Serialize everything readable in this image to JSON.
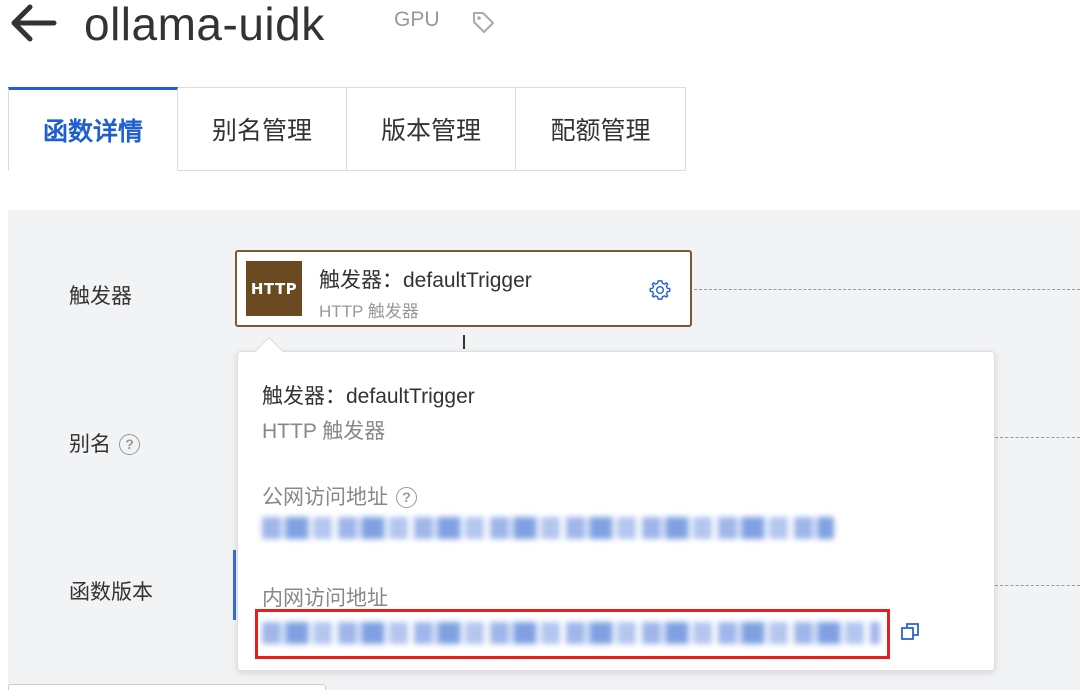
{
  "header": {
    "title": "ollama-uidk",
    "tag": "GPU"
  },
  "tabs": [
    {
      "label": "函数详情",
      "active": true
    },
    {
      "label": "别名管理",
      "active": false
    },
    {
      "label": "版本管理",
      "active": false
    },
    {
      "label": "配额管理",
      "active": false
    }
  ],
  "rows": {
    "trigger_label": "触发器",
    "alias_label": "别名",
    "version_label": "函数版本"
  },
  "trigger_card": {
    "badge": "HTTP",
    "name": "触发器：defaultTrigger",
    "type": "HTTP 触发器"
  },
  "popover": {
    "title": "触发器：defaultTrigger",
    "subtitle": "HTTP 触发器",
    "public_label": "公网访问地址",
    "internal_label": "内网访问地址"
  },
  "colors": {
    "accent": "#1f5fd1",
    "badge": "#6b4a22",
    "card_border": "#7a5a2e",
    "highlight": "#e3201b",
    "panel_bg": "#f2f3f5"
  },
  "icons": [
    "back-arrow-icon",
    "tag-icon",
    "help-icon",
    "gear-icon",
    "copy-icon"
  ]
}
